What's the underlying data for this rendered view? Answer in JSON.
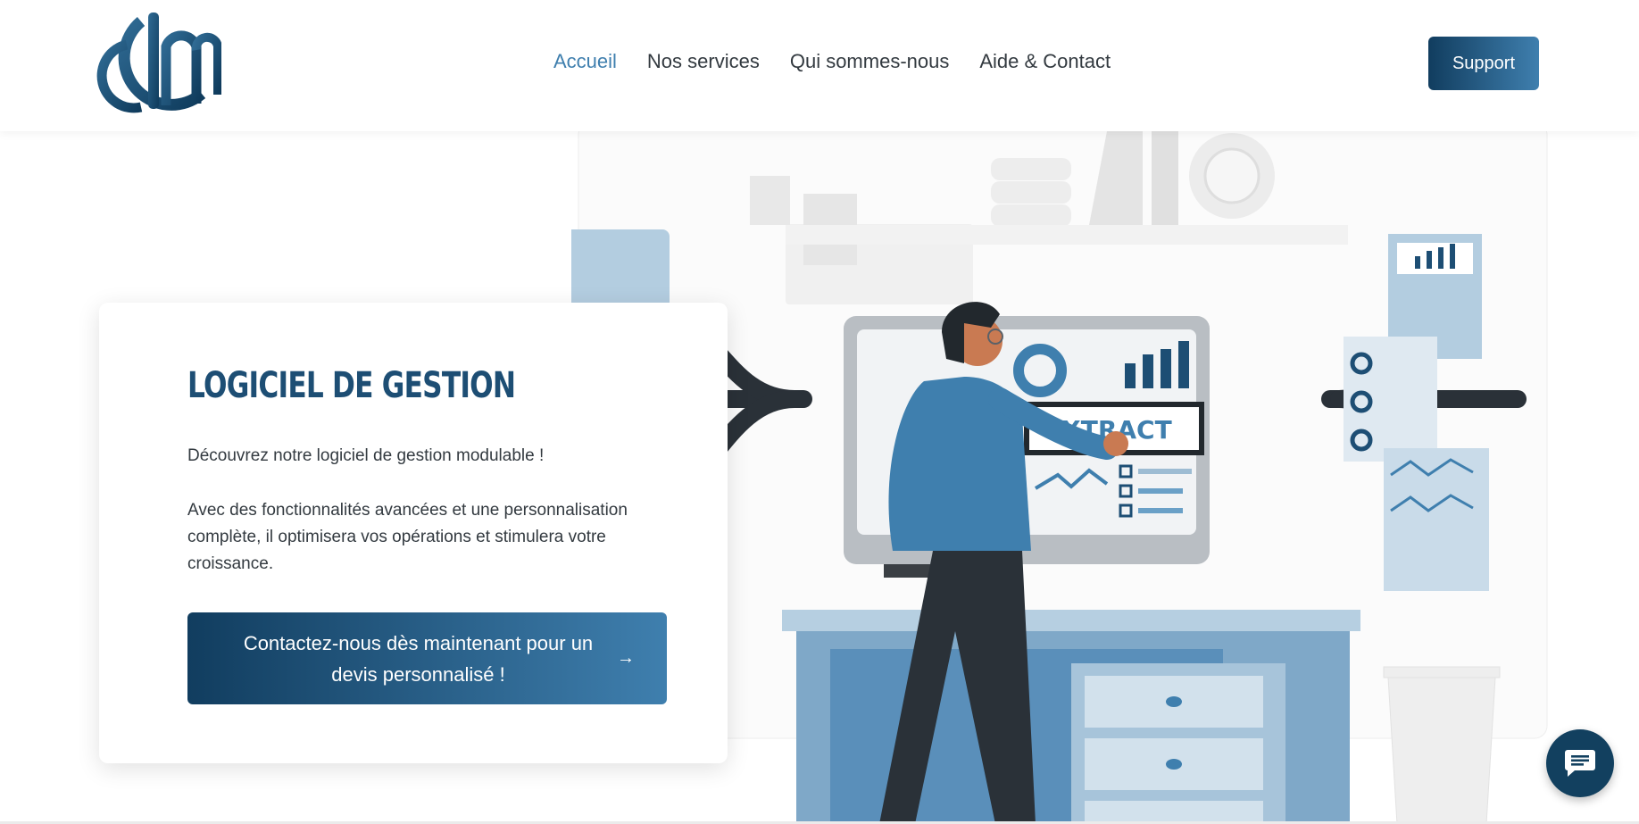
{
  "brand": {
    "logo_alt": "GIM"
  },
  "nav": {
    "items": [
      {
        "label": "Accueil",
        "active": true
      },
      {
        "label": "Nos services",
        "active": false
      },
      {
        "label": "Qui sommes-nous",
        "active": false
      },
      {
        "label": "Aide & Contact",
        "active": false
      }
    ],
    "support_label": "Support"
  },
  "hero": {
    "title": "LOGICIEL DE GESTION",
    "intro": "Découvrez notre logiciel de gestion modulable !",
    "description": "Avec des fonctionnalités avancées et une personnalisation complète, il optimisera vos opérations et stimulera votre croissance.",
    "cta_label": "Contactez-nous dès maintenant pour un devis personnalisé !",
    "cta_icon": "arrow-right-icon"
  },
  "illustration": {
    "screen_text": "EXTRACT"
  },
  "chat": {
    "icon": "chat-bubble-icon"
  },
  "colors": {
    "primary_dark": "#113d5f",
    "primary_light": "#3f7fae",
    "nav_active": "#3f7fae",
    "title": "#1d4e74"
  }
}
